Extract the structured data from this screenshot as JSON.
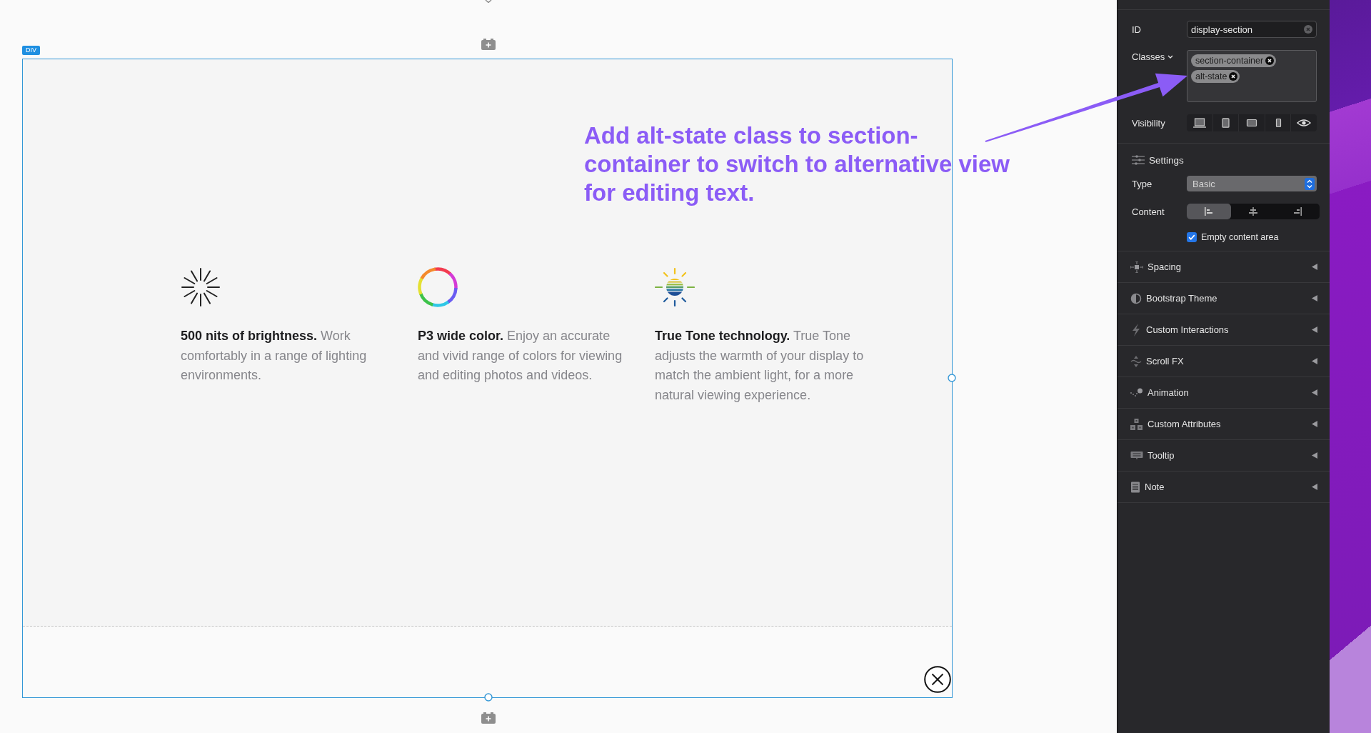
{
  "canvas": {
    "element_tag": "DIV",
    "features": [
      {
        "text": "**500 nits of brightness.** Work comfortably in a range of lighting environments."
      },
      {
        "text": "**P3 wide color.** Enjoy an accurate and vivid range of colors for viewing and editing photos and videos."
      },
      {
        "text": "**True Tone technology.** True Tone adjusts the warmth of your display to match the ambient light, for a more natural viewing experience."
      }
    ]
  },
  "annotation": {
    "text": "Add alt-state class to section-container to switch to alternative view for editing text."
  },
  "panel": {
    "id": {
      "label": "ID",
      "value": "display-section"
    },
    "classes": {
      "label": "Classes",
      "tags": [
        "section-container",
        "alt-state"
      ]
    },
    "visibility": {
      "label": "Visibility"
    },
    "settings": {
      "title": "Settings",
      "type": {
        "label": "Type",
        "value": "Basic"
      },
      "content": {
        "label": "Content",
        "options": [
          {
            "selected": true
          },
          {
            "selected": false
          },
          {
            "selected": false
          }
        ]
      },
      "empty_content_area": {
        "label": "Empty content area",
        "checked": true
      }
    },
    "sections": [
      {
        "label": "Spacing",
        "expanded": false
      },
      {
        "label": "Bootstrap Theme",
        "expanded": false
      },
      {
        "label": "Custom Interactions",
        "expanded": false
      },
      {
        "label": "Scroll FX",
        "expanded": false
      },
      {
        "label": "Animation",
        "expanded": false
      },
      {
        "label": "Custom Attributes",
        "expanded": false
      },
      {
        "label": "Tooltip",
        "expanded": false
      },
      {
        "label": "Note",
        "expanded": false
      }
    ]
  }
}
